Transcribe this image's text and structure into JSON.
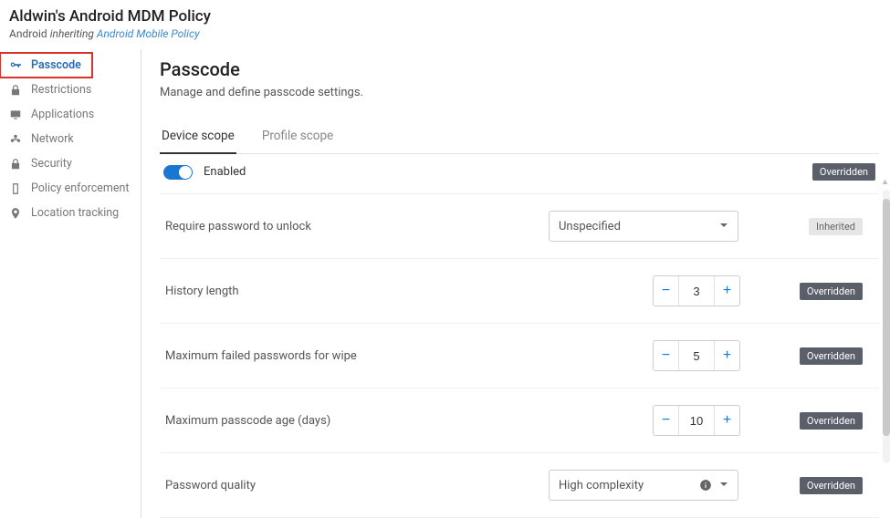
{
  "header": {
    "title": "Aldwin's Android MDM Policy",
    "platform": "Android",
    "inherit_word": "inheriting",
    "link": "Android Mobile Policy"
  },
  "sidebar": {
    "items": [
      {
        "key": "passcode",
        "label": "Passcode",
        "active": true
      },
      {
        "key": "restrictions",
        "label": "Restrictions"
      },
      {
        "key": "applications",
        "label": "Applications"
      },
      {
        "key": "network",
        "label": "Network"
      },
      {
        "key": "security",
        "label": "Security"
      },
      {
        "key": "policy-enforcement",
        "label": "Policy enforcement"
      },
      {
        "key": "location-tracking",
        "label": "Location tracking"
      }
    ]
  },
  "main": {
    "title": "Passcode",
    "description": "Manage and define passcode settings.",
    "tabs": [
      {
        "label": "Device scope",
        "active": true
      },
      {
        "label": "Profile scope"
      }
    ],
    "enabled_label": "Enabled",
    "enabled_badge": "Overridden",
    "rows": [
      {
        "name": "Require password to unlock",
        "control": "select",
        "value": "Unspecified",
        "badge": "Inherited"
      },
      {
        "name": "History length",
        "control": "stepper",
        "value": "3",
        "badge": "Overridden"
      },
      {
        "name": "Maximum failed passwords for wipe",
        "control": "stepper",
        "value": "5",
        "badge": "Overridden"
      },
      {
        "name": "Maximum passcode age (days)",
        "control": "stepper",
        "value": "10",
        "badge": "Overridden"
      },
      {
        "name": "Password quality",
        "control": "select-info",
        "value": "High complexity",
        "badge": "Overridden"
      }
    ]
  }
}
